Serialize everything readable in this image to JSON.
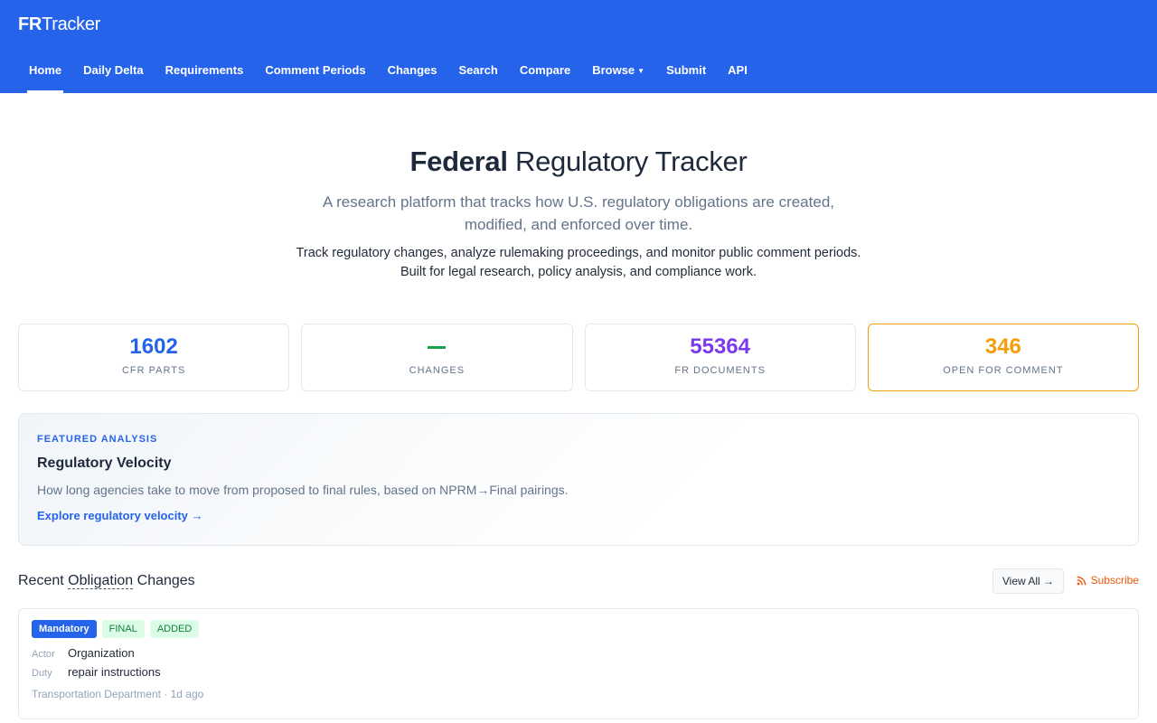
{
  "brand": {
    "bold": "FR",
    "regular": "Tracker"
  },
  "nav": [
    {
      "label": "Home"
    },
    {
      "label": "Daily Delta"
    },
    {
      "label": "Requirements"
    },
    {
      "label": "Comment Periods"
    },
    {
      "label": "Changes"
    },
    {
      "label": "Search"
    },
    {
      "label": "Compare"
    },
    {
      "label": "Browse"
    },
    {
      "label": "Submit"
    },
    {
      "label": "API"
    }
  ],
  "hero": {
    "title_bold": "Federal",
    "title_rest": " Regulatory Tracker",
    "subtitle_line1": "A research platform that tracks how U.S. regulatory obligations are created,",
    "subtitle_line2": "modified, and enforced over time.",
    "desc_line1": "Track regulatory changes, analyze rulemaking proceedings, and monitor public comment periods.",
    "desc_line2": "Built for legal research, policy analysis, and compliance work."
  },
  "stats": [
    {
      "value": "1602",
      "label": "CFR PARTS",
      "color": "#2563eb"
    },
    {
      "value": "",
      "label": "CHANGES",
      "color": "#16a34a"
    },
    {
      "value": "55364",
      "label": "FR DOCUMENTS",
      "color": "#7c3aed"
    },
    {
      "value": "346",
      "label": "OPEN FOR COMMENT",
      "color": "#f59e0b"
    }
  ],
  "featured": {
    "kicker": "FEATURED ANALYSIS",
    "title": "Regulatory Velocity",
    "description": "How long agencies take to move from proposed to final rules, based on NPRM→Final pairings.",
    "link": "Explore regulatory velocity →"
  },
  "recent": {
    "title_pre": "Recent ",
    "title_dotted": "Obligation",
    "title_post": " Changes",
    "view_all": "View All →",
    "subscribe": "Subscribe"
  },
  "change": {
    "badges": [
      "Mandatory",
      "FINAL",
      "ADDED"
    ],
    "actor_label": "Actor",
    "actor": "Organization",
    "duty_label": "Duty",
    "duty": "repair instructions",
    "meta": "Transportation Department · 1d ago"
  }
}
